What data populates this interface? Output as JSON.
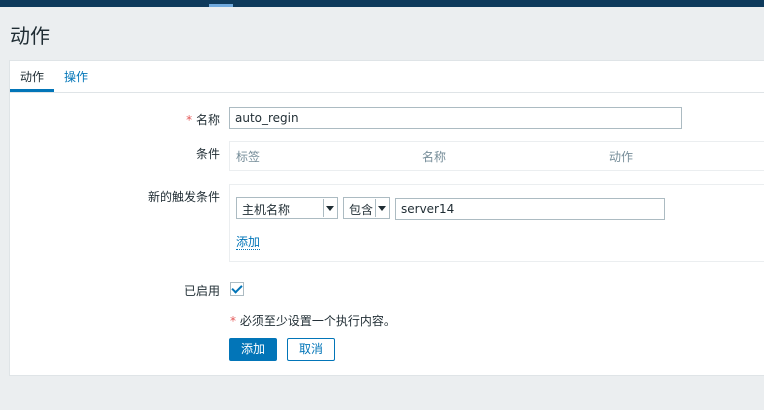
{
  "page": {
    "title": "动作"
  },
  "tabs": [
    {
      "label": "动作",
      "active": true
    },
    {
      "label": "操作",
      "active": false
    }
  ],
  "form": {
    "name": {
      "required_mark": "*",
      "label": "名称",
      "value": "auto_regin"
    },
    "conditions": {
      "label": "条件",
      "columns": [
        "标签",
        "名称",
        "动作"
      ]
    },
    "new_condition": {
      "label": "新的触发条件",
      "type_select": "主机名称",
      "operator_select": "包含",
      "value": "server14",
      "add_link": "添加"
    },
    "enabled": {
      "label": "已启用",
      "checked": true
    },
    "notice": {
      "required_mark": "*",
      "text": "必须至少设置一个执行内容。"
    },
    "buttons": {
      "add": "添加",
      "cancel": "取消"
    }
  },
  "colors": {
    "accent": "#0275b8",
    "topbar": "#0e3a5c",
    "required": "#e45959"
  }
}
